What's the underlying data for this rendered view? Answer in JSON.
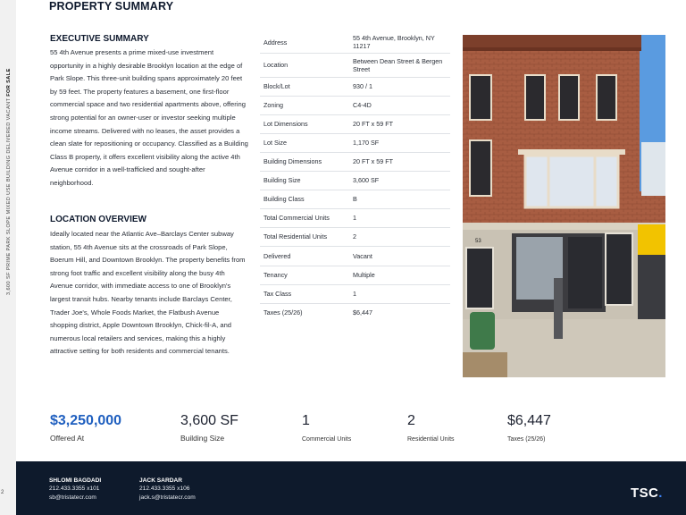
{
  "sidebar": {
    "vertical_text": "3,600 SF PRIME PARK SLOPE MIXED USE BUILDING DELIVERED VACANT",
    "vertical_bold": "FOR SALE",
    "page_number": "2"
  },
  "page_title": "PROPERTY SUMMARY",
  "executive_summary": {
    "heading": "EXECUTIVE SUMMARY",
    "body": "55 4th Avenue presents a prime mixed-use investment opportunity in a highly desirable Brooklyn location at the edge of Park Slope. This three-unit building spans approximately 20 feet by 59 feet. The property features a basement, one first-floor commercial space and two residential apartments above, offering strong potential for an owner-user or investor seeking multiple income streams. Delivered with no leases, the asset provides a clean slate for repositioning or occupancy. Classified as a Building Class B property, it offers excellent visibility along the active 4th Avenue corridor in a well-trafficked and sought-after neighborhood."
  },
  "location_overview": {
    "heading": "LOCATION OVERVIEW",
    "body": "Ideally located near the Atlantic Ave–Barclays Center subway station, 55 4th Avenue sits at the crossroads of Park Slope, Boerum Hill, and Downtown Brooklyn. The property benefits from strong foot traffic and excellent visibility along the busy 4th Avenue corridor, with immediate access to one of Brooklyn's largest transit hubs. Nearby tenants include Barclays Center, Trader Joe's, Whole Foods Market, the Flatbush Avenue shopping district, Apple Downtown Brooklyn, Chick-fil-A, and numerous local retailers and services, making this a highly attractive setting for both residents and commercial tenants."
  },
  "facts": [
    {
      "label": "Address",
      "value": "55 4th Avenue, Brooklyn, NY 11217"
    },
    {
      "label": "Location",
      "value": "Between Dean Street & Bergen Street"
    },
    {
      "label": "Block/Lot",
      "value": "930 / 1"
    },
    {
      "label": "Zoning",
      "value": "C4-4D"
    },
    {
      "label": "Lot Dimensions",
      "value": "20 FT x 59 FT"
    },
    {
      "label": "Lot Size",
      "value": "1,170 SF"
    },
    {
      "label": "Building Dimensions",
      "value": "20 FT x 59 FT"
    },
    {
      "label": "Building Size",
      "value": "3,600 SF"
    },
    {
      "label": "Building Class",
      "value": "B"
    },
    {
      "label": "Total Commercial Units",
      "value": "1"
    },
    {
      "label": "Total Residential Units",
      "value": "2"
    },
    {
      "label": "Delivered",
      "value": "Vacant"
    },
    {
      "label": "Tenancy",
      "value": "Multiple"
    },
    {
      "label": "Tax Class",
      "value": "1"
    },
    {
      "label": "Taxes (25/26)",
      "value": "$6,447"
    }
  ],
  "photo": {
    "storefront_number": "53"
  },
  "stats": [
    {
      "value": "$3,250,000",
      "label": "Offered At"
    },
    {
      "value": "3,600 SF",
      "label": "Building Size"
    },
    {
      "value": "1",
      "label": "Commercial Units"
    },
    {
      "value": "2",
      "label": "Residential Units"
    },
    {
      "value": "$6,447",
      "label": "Taxes (25/26)"
    }
  ],
  "agents": [
    {
      "name": "SHLOMI BAGDADI",
      "phone": "212.433.3355 x101",
      "email": "sb@tristatecr.com"
    },
    {
      "name": "JACK SARDAR",
      "phone": "212.433.3355 x106",
      "email": "jack.s@tristatecr.com"
    }
  ],
  "logo": {
    "text": "TSC",
    "dot": "."
  },
  "colors": {
    "accent_blue": "#1f5fbf",
    "footer_navy": "#0e1a2c",
    "logo_dot": "#3b82f6"
  }
}
